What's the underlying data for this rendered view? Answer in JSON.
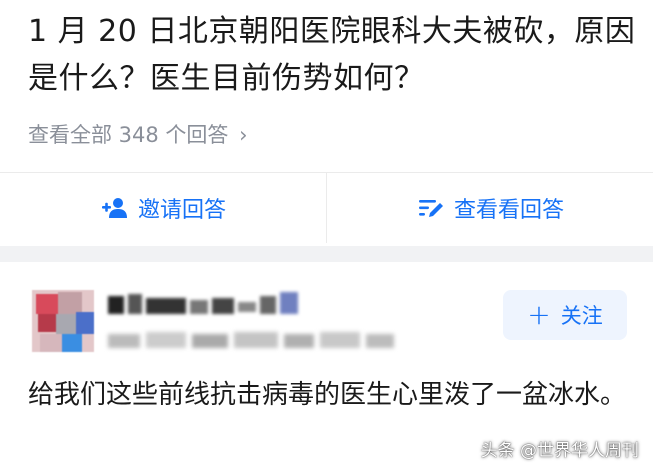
{
  "question": {
    "title": "1 月 20 日北京朝阳医院眼科大夫被砍，原因是什么？医生目前伤势如何？",
    "view_all_answers": "查看全部 348 个回答",
    "chevron": "›"
  },
  "actions": {
    "invite_label": "邀请回答",
    "view_label": "查看看回答"
  },
  "answer": {
    "follow_label": "关注",
    "follow_plus": "+",
    "text": "给我们这些前线抗击病毒的医生心里泼了一盆冰水。"
  },
  "watermark": {
    "text": "头条 @世界华人周刊"
  },
  "colors": {
    "accent": "#1772f6",
    "follow_bg": "#eef4fe",
    "muted_text": "#8a8f99",
    "page_bg": "#f1f2f4"
  }
}
